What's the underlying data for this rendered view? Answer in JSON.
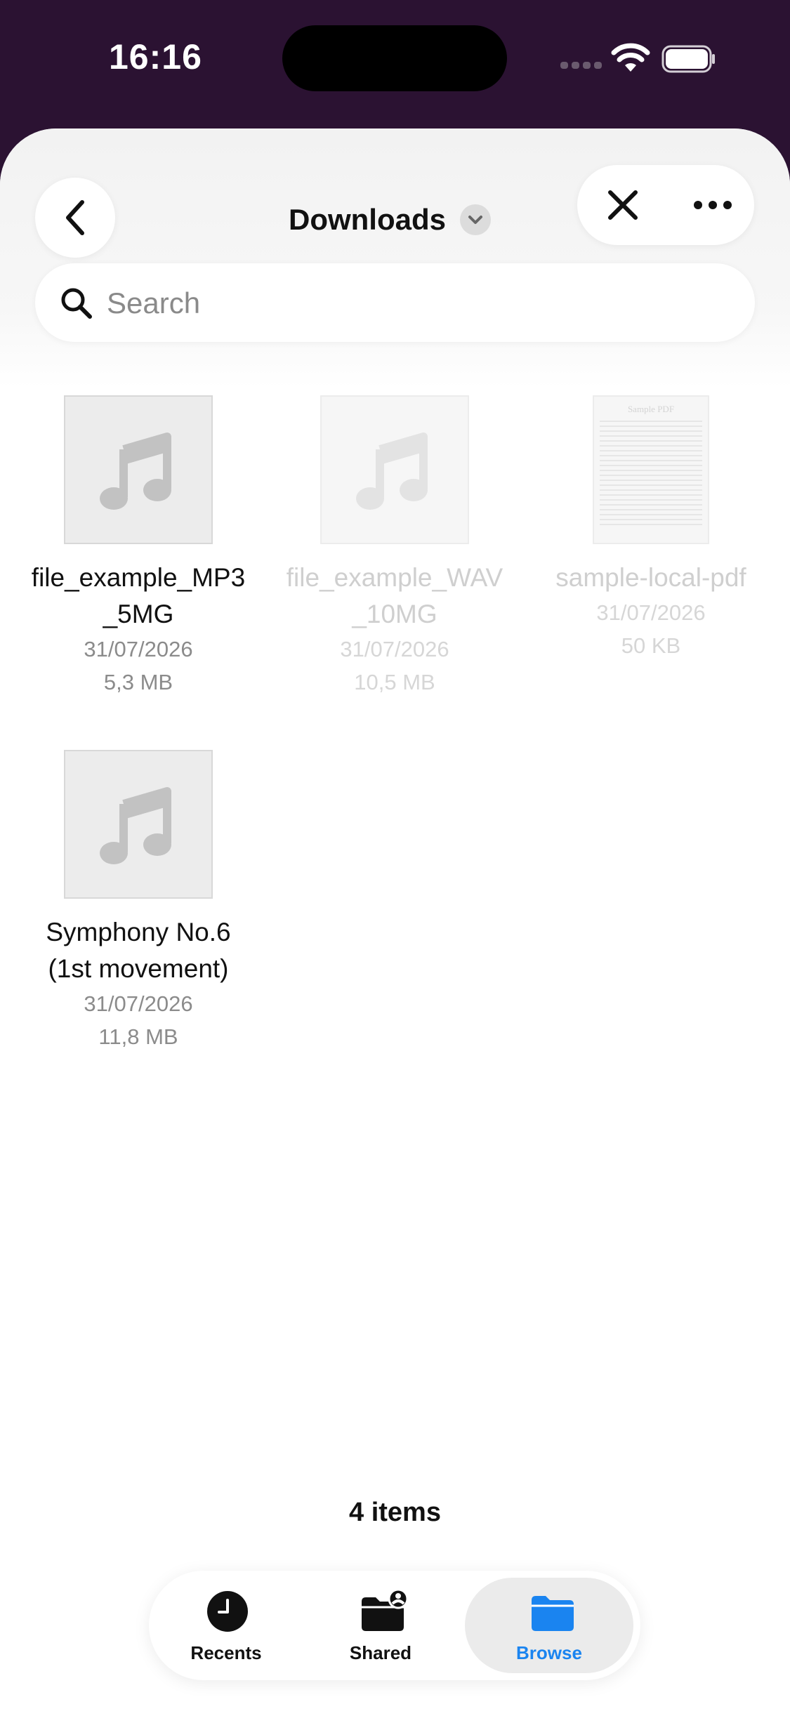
{
  "status_bar": {
    "time": "16:16"
  },
  "header": {
    "title": "Downloads"
  },
  "search": {
    "placeholder": "Search"
  },
  "files": [
    {
      "name": "file_example_MP3\n_5MG",
      "date": "31/07/2026",
      "size": "5,3 MB",
      "type": "audio",
      "dimmed": false
    },
    {
      "name": "file_example_WAV\n_10MG",
      "date": "31/07/2026",
      "size": "10,5 MB",
      "type": "audio",
      "dimmed": true
    },
    {
      "name": "sample-local-pdf",
      "date": "31/07/2026",
      "size": "50 KB",
      "type": "pdf",
      "dimmed": true,
      "thumb_title": "Sample PDF"
    },
    {
      "name": "Symphony No.6\n(1st movement)",
      "date": "31/07/2026",
      "size": "11,8 MB",
      "type": "audio",
      "dimmed": false
    }
  ],
  "footer": {
    "items_count": "4 items"
  },
  "tabs": [
    {
      "label": "Recents",
      "icon": "clock-icon",
      "active": false
    },
    {
      "label": "Shared",
      "icon": "shared-folder-icon",
      "active": false
    },
    {
      "label": "Browse",
      "icon": "folder-icon",
      "active": true
    }
  ],
  "colors": {
    "accent": "#1a84f0",
    "status_bar_bg": "#2b1232"
  }
}
